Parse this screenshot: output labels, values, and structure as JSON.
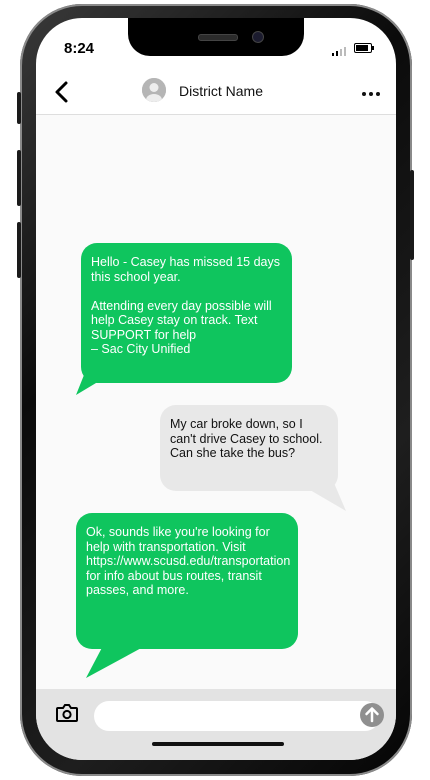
{
  "status_bar": {
    "time": "8:24"
  },
  "header": {
    "contact_name": "District Name",
    "back_icon": "chevron-left-icon",
    "more_icon": "more-horizontal-icon"
  },
  "messages": [
    {
      "direction": "incoming",
      "text": "Hello - Casey has missed 15 days this school year.\n\nAttending every day possible will help Casey stay on track. Text SUPPORT for help\n– Sac City Unified"
    },
    {
      "direction": "outgoing",
      "text": "My car broke down, so I can't drive Casey to school. Can she take the bus?"
    },
    {
      "direction": "incoming",
      "text": "Ok, sounds like you're looking for help with transportation. Visit https://www.scusd.edu/transportation for info about bus routes, transit passes, and more."
    }
  ],
  "composer": {
    "placeholder": "",
    "camera_icon": "camera-icon",
    "send_icon": "arrow-up-icon"
  },
  "colors": {
    "incoming_bubble": "#0fc55e",
    "outgoing_bubble": "#e8e8e8"
  }
}
